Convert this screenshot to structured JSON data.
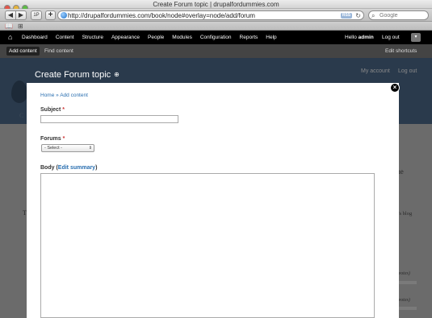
{
  "browser": {
    "window_title": "Create Forum topic | drupalfordummies.com",
    "url": "http://drupalfordummies.com/book/node#overlay=node/add/forum",
    "rss_label": "RSS",
    "search_placeholder": "Google",
    "back_glyph": "◀",
    "forward_glyph": "▶",
    "add_glyph": "+",
    "reload_glyph": "↻",
    "tabs_glyph": "1P",
    "search_glyph": "⌕",
    "bookmarks_glyph": "📖",
    "grid_glyph": "⊞"
  },
  "admin_toolbar": {
    "home_icon": "⌂",
    "menu": [
      "Dashboard",
      "Content",
      "Structure",
      "Appearance",
      "People",
      "Modules",
      "Configuration",
      "Reports",
      "Help"
    ],
    "hello_prefix": "Hello ",
    "username": "admin",
    "logout": "Log out",
    "toggle": "▾"
  },
  "shortcuts": {
    "add_content": "Add content",
    "find_content": "Find content",
    "edit_shortcuts": "Edit shortcuts"
  },
  "background_site": {
    "my_account": "My account",
    "log_out": "Log out",
    "side_text_1": "s the",
    "side_text_2": "mber's blog",
    "side_text_3": "(48 votes)",
    "side_text_4": "(48 votes)",
    "left_fragment_1": "C",
    "left_fragment_2": "T"
  },
  "overlay": {
    "title": "Create Forum topic",
    "title_icon": "⊕",
    "close_glyph": "×",
    "breadcrumb": "Home » Add content",
    "subject_label": "Subject",
    "required_mark": "*",
    "forums_label": "Forums",
    "forums_selected": "- Select -",
    "select_arrow": "⇕",
    "body_label": "Body",
    "body_link_open": " (",
    "body_link": "Edit summary",
    "body_link_close": ")"
  }
}
